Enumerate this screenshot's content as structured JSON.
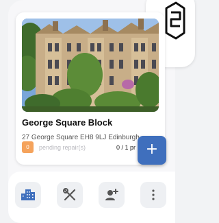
{
  "property": {
    "name": "George Square Block",
    "address": "27 George Square EH8 9LJ Edinburgh",
    "pending_count": "0",
    "pending_label": "pending repair(s)",
    "progress_text": "0 / 1 pr",
    "photo_icon": "building-photo"
  },
  "fab": {
    "label": "+",
    "icon": "plus-icon"
  },
  "nav": {
    "items": [
      {
        "icon": "buildings-icon"
      },
      {
        "icon": "tools-icon"
      },
      {
        "icon": "add-user-icon"
      },
      {
        "icon": "more-vertical-icon"
      }
    ]
  },
  "colors": {
    "accent": "#3f6fbd",
    "badge": "#f5a35c",
    "background": "#f2f3f5"
  }
}
